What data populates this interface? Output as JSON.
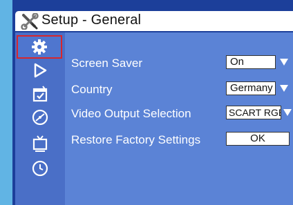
{
  "window": {
    "title": "Setup - General"
  },
  "sidebar": {
    "items": [
      {
        "icon": "gear-icon",
        "selected": true
      },
      {
        "icon": "play-icon",
        "selected": false
      },
      {
        "icon": "parental-control-icon",
        "selected": false
      },
      {
        "icon": "disc-icon",
        "selected": false
      },
      {
        "icon": "tv-icon",
        "selected": false
      },
      {
        "icon": "clock-icon",
        "selected": false
      }
    ]
  },
  "settings": [
    {
      "label": "Screen Saver",
      "value": "On"
    },
    {
      "label": "Country",
      "value": "Germany"
    },
    {
      "label": "Video Output Selection",
      "value": "SCART RGB"
    },
    {
      "label": "Restore Factory Settings",
      "button": "OK"
    }
  ],
  "colors": {
    "background": "#61b4e4",
    "frame": "#1c3f9a",
    "sidebar": "#4a6fc7",
    "content": "#5b83d6",
    "selection": "#d8262b"
  }
}
